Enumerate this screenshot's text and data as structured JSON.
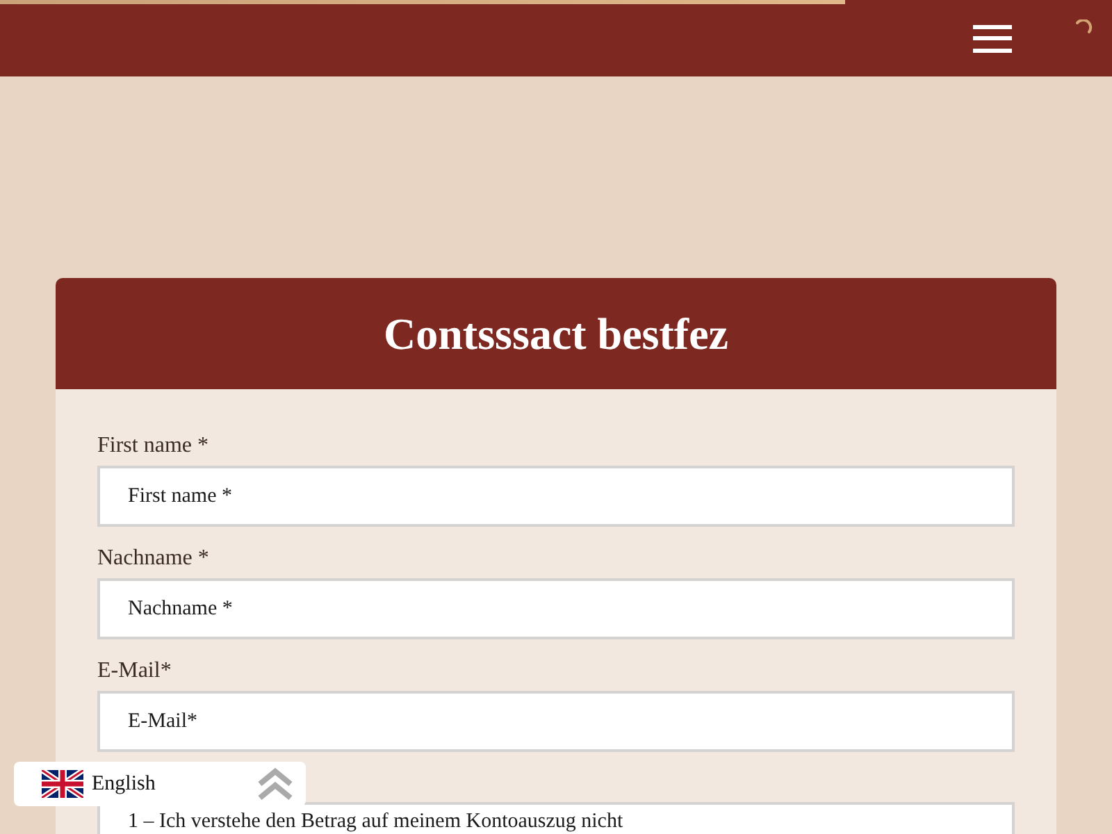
{
  "loading_bar": {
    "level": 0.76
  },
  "card": {
    "title": "Contsssact bestfez",
    "fields": [
      {
        "kind": "input",
        "label": "First name *",
        "placeholder": "First name *"
      },
      {
        "kind": "input",
        "label": "Nachname *",
        "placeholder": "Nachname *"
      },
      {
        "kind": "input",
        "label": "E-Mail*",
        "placeholder": "E-Mail*"
      },
      {
        "kind": "select",
        "value": "1 – Ich verstehe den Betrag auf meinem Kontoauszug nicht"
      }
    ]
  },
  "language_switcher": {
    "label": "English"
  }
}
